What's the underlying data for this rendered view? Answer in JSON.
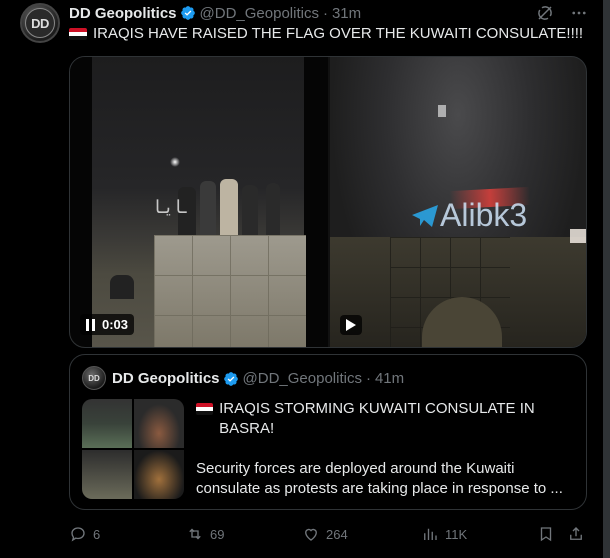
{
  "author": {
    "name": "DD Geopolitics",
    "handle": "@DD_Geopolitics",
    "time": "31m",
    "avatar_initials": "DD"
  },
  "tweet": {
    "flag_icon": "iraq-flag-icon",
    "text": "IRAQIS HAVE RAISED THE FLAG OVER THE KUWAITI CONSULATE!!!!"
  },
  "media": {
    "video1": {
      "time": "0:03",
      "state": "playing"
    },
    "video1_watermark": "ـا يـا",
    "video2": {
      "state": "paused"
    },
    "video2_watermark": "Alibk3"
  },
  "quoted": {
    "name": "DD Geopolitics",
    "handle": "@DD_Geopolitics",
    "time": "41m",
    "avatar_initials": "DD",
    "title": "IRAQIS STORMING KUWAITI CONSULATE IN BASRA!",
    "body": "Security forces are deployed around the Kuwaiti consulate as protests are taking place in response to ..."
  },
  "actions": {
    "replies": "6",
    "reposts": "69",
    "likes": "264",
    "views": "11K"
  },
  "colors": {
    "background": "#000000",
    "text": "#e7e9ea",
    "muted": "#71767b",
    "border": "#2f3336",
    "verified": "#1d9bf0",
    "accent_telegram": "#2aabee"
  }
}
